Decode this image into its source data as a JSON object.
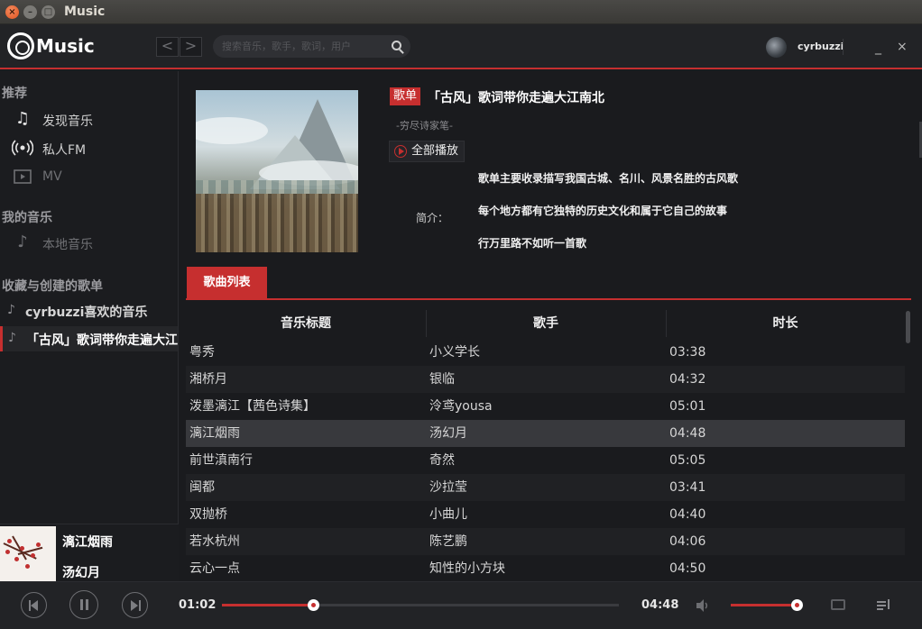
{
  "window": {
    "title": "Music",
    "close": "×",
    "minimize": "–",
    "maximize": "□"
  },
  "header": {
    "brand": "Music",
    "back": "<",
    "forward": ">",
    "search_placeholder": "搜索音乐，歌手，歌词，用户",
    "username": "cyrbuzzi",
    "minimize": "_",
    "close": "×"
  },
  "sidebar": {
    "section_recommend": "推荐",
    "recommend_items": [
      {
        "label": "发现音乐",
        "icon": "music-note-icon"
      },
      {
        "label": "私人FM",
        "icon": "radio-icon"
      },
      {
        "label": "MV",
        "icon": "video-icon"
      }
    ],
    "section_my_music": "我的音乐",
    "my_music_items": [
      {
        "label": "本地音乐",
        "icon": "music-note-icon"
      }
    ],
    "section_playlists": "收藏与创建的歌单",
    "playlists": [
      {
        "label": "cyrbuzzi喜欢的音乐"
      },
      {
        "label": "「古风」歌词带你走遍大江南北"
      }
    ]
  },
  "now_playing": {
    "title": "漓江烟雨",
    "artist": "汤幻月"
  },
  "playlist": {
    "badge": "歌单",
    "title": "「古风」歌词带你走遍大江南北",
    "creator": "-穷尽诗家笔-",
    "play_all": "全部播放",
    "intro_label": "简介：",
    "intro_lines": [
      "歌单主要收录描写我国古城、名川、风景名胜的古风歌",
      "每个地方都有它独特的历史文化和属于它自己的故事",
      "行万里路不如听一首歌"
    ],
    "tab_songs": "歌曲列表"
  },
  "table": {
    "headers": [
      "音乐标题",
      "歌手",
      "时长"
    ],
    "rows": [
      [
        "粤秀",
        "小义学长",
        "03:38"
      ],
      [
        "湘桥月",
        "银临",
        "04:32"
      ],
      [
        "泼墨漓江【茜色诗集】",
        "泠鸢yousa",
        "05:01"
      ],
      [
        "漓江烟雨",
        "汤幻月",
        "04:48"
      ],
      [
        "前世滇南行",
        "奇然",
        "05:05"
      ],
      [
        "闽都",
        "沙拉莹",
        "03:41"
      ],
      [
        "双抛桥",
        "小曲儿",
        "04:40"
      ],
      [
        "若水杭州",
        "陈艺鹏",
        "04:06"
      ],
      [
        "云心一点",
        "知性的小方块",
        "04:50"
      ]
    ],
    "selected_index": 3
  },
  "player": {
    "elapsed": "01:02",
    "duration": "04:48",
    "progress_fraction": 0.23,
    "volume_fraction": 0.98
  },
  "colors": {
    "accent": "#c62f2f",
    "background": "#1a1b1e",
    "sidebar": "#1b1c1f",
    "selected_row": "#38393d"
  }
}
